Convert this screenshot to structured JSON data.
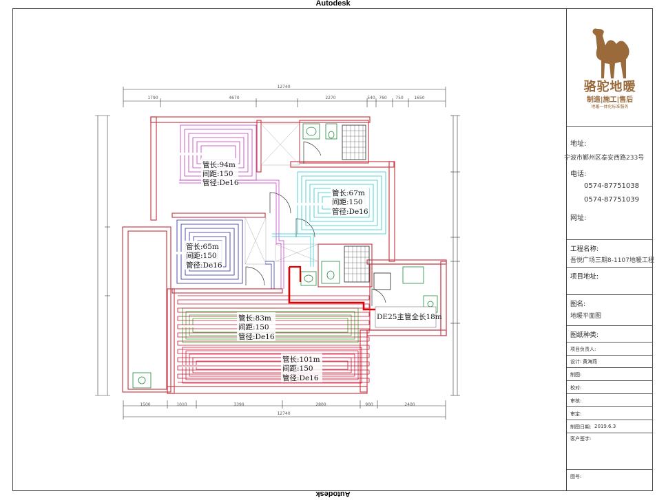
{
  "banner": {
    "top": "Autodesk",
    "bottom": "Autodesk"
  },
  "dimensions": {
    "top_total": "12740",
    "top_segments": [
      "1790",
      "4670",
      "2270",
      "540",
      "760",
      "750",
      "1650"
    ],
    "bottom_total": "12740",
    "bottom_segments": [
      "1500",
      "1010",
      "3390",
      "2800",
      "900",
      "2400"
    ]
  },
  "loops": [
    {
      "length": "管长:94m",
      "spacing": "间距:150",
      "diameter": "管径:De16"
    },
    {
      "length": "管长:67m",
      "spacing": "间距:150",
      "diameter": "管径:De16"
    },
    {
      "length": "管长:65m",
      "spacing": "间距:150",
      "diameter": "管径:De16"
    },
    {
      "length": "管长:83m",
      "spacing": "间距:150",
      "diameter": "管径:De16"
    },
    {
      "length": "管长:101m",
      "spacing": "间距:150",
      "diameter": "管径:De16"
    }
  ],
  "main_pipe_label": "DE25主管全长18m",
  "title_block": {
    "brand_name": "骆驼地暖",
    "brand_slogan": "制造|施工|售后",
    "brand_sub": "地暖一体化标准服务",
    "address_label": "地址:",
    "address": "宁波市鄞州区泰安西路233号",
    "phone_label": "电话:",
    "phone1": "0574-87751038",
    "phone2": "0574-87751039",
    "website_label": "网址:",
    "project_name_label": "工程名称:",
    "project_name": "吾悦广场三期8-1107地暖工程",
    "project_address_label": "项目地址:",
    "drawing_name_label": "图名:",
    "drawing_name": "地暖平面图",
    "drawing_type_label": "图纸种类:",
    "project_lead_label": "项目负责人:",
    "designer_label": "设计:",
    "designer": "黄海燕",
    "draft_label": "制图:",
    "check_label": "校对:",
    "review_label": "审核:",
    "approve_label": "审定:",
    "date_label": "制图日期:",
    "date": "2019.6.3",
    "client_sign_label": "客户签字:",
    "figure_no_label": "图号:"
  },
  "colors": {
    "wall": "#c8404a",
    "loop_94": "#c030c0",
    "loop_67": "#20c8d0",
    "loop_65": "#2020a0",
    "loop_83": "#20b020",
    "loop_101": "#d01030",
    "main_pipe": "#e00000",
    "brand": "#9a6a3a"
  }
}
